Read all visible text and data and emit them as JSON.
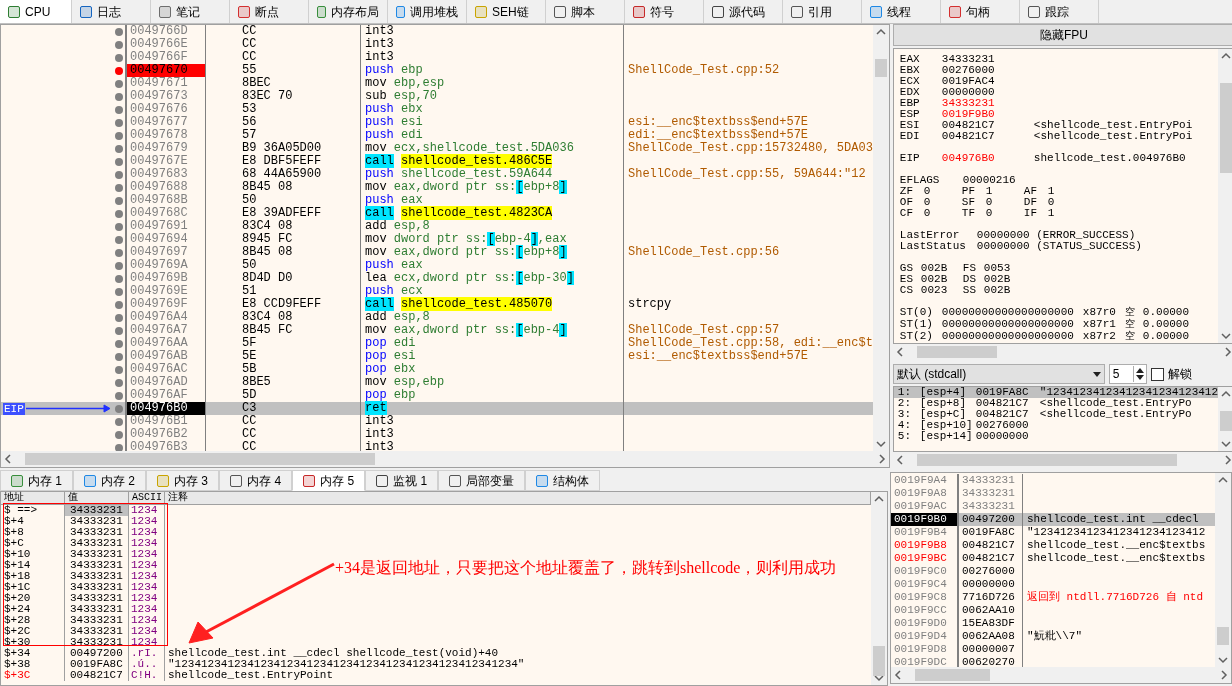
{
  "top_tabs": [
    {
      "label": "CPU",
      "selected": true
    },
    {
      "label": "日志",
      "selected": false
    },
    {
      "label": "笔记",
      "selected": false
    },
    {
      "label": "断点",
      "selected": false
    },
    {
      "label": "内存布局",
      "selected": false
    },
    {
      "label": "调用堆栈",
      "selected": false
    },
    {
      "label": "SEH链",
      "selected": false
    },
    {
      "label": "脚本",
      "selected": false
    },
    {
      "label": "符号",
      "selected": false
    },
    {
      "label": "源代码",
      "selected": false
    },
    {
      "label": "引用",
      "selected": false
    },
    {
      "label": "线程",
      "selected": false
    },
    {
      "label": "句柄",
      "selected": false
    },
    {
      "label": "跟踪",
      "selected": false
    }
  ],
  "disassembly": {
    "eip_label": "EIP",
    "rows": [
      {
        "address": "0049766D",
        "bytes": "CC",
        "mnemonic": "int3",
        "kind": "other",
        "breakpoint": false,
        "eip": false
      },
      {
        "address": "0049766E",
        "bytes": "CC",
        "mnemonic": "int3",
        "kind": "other",
        "breakpoint": false,
        "eip": false
      },
      {
        "address": "0049766F",
        "bytes": "CC",
        "mnemonic": "int3",
        "kind": "other",
        "breakpoint": false,
        "eip": false
      },
      {
        "address": "00497670",
        "bytes": "55",
        "mnemonic": "push",
        "operands": "ebp",
        "comment": "ShellCode_Test.cpp:52",
        "kind": "stack",
        "breakpoint": true,
        "eip": false
      },
      {
        "address": "00497671",
        "bytes": "8BEC",
        "mnemonic": "mov",
        "operands": "ebp,esp",
        "kind": "other",
        "breakpoint": false,
        "eip": false
      },
      {
        "address": "00497673",
        "bytes": "83EC 70",
        "mnemonic": "sub",
        "operands": "esp,70",
        "kind": "other",
        "breakpoint": false,
        "eip": false
      },
      {
        "address": "00497676",
        "bytes": "53",
        "mnemonic": "push",
        "operands": "ebx",
        "kind": "stack",
        "breakpoint": false,
        "eip": false
      },
      {
        "address": "00497677",
        "bytes": "56",
        "mnemonic": "push",
        "operands": "esi",
        "comment": "esi:__enc$textbss$end+57E",
        "kind": "stack",
        "breakpoint": false,
        "eip": false
      },
      {
        "address": "00497678",
        "bytes": "57",
        "mnemonic": "push",
        "operands": "edi",
        "comment": "edi:__enc$textbss$end+57E",
        "kind": "stack",
        "breakpoint": false,
        "eip": false
      },
      {
        "address": "00497679",
        "bytes": "B9 36A05D00",
        "mnemonic": "mov",
        "operands": "ecx,shellcode_test.5DA036",
        "comment": "ShellCode_Test.cpp:15732480, 5DA03",
        "kind": "other",
        "breakpoint": false,
        "eip": false
      },
      {
        "address": "0049767E",
        "bytes": "E8 DBF5FEFF",
        "mnemonic": "call",
        "operands": "shellcode_test.486C5E",
        "kind": "call",
        "breakpoint": false,
        "eip": false
      },
      {
        "address": "00497683",
        "bytes": "68 44A65900",
        "mnemonic": "push",
        "operands": "shellcode_test.59A644",
        "comment": "ShellCode_Test.cpp:55, 59A644:\"12",
        "kind": "stack",
        "breakpoint": false,
        "eip": false
      },
      {
        "address": "00497688",
        "bytes": "8B45 08",
        "mnemonic": "mov",
        "operands": "eax,dword ptr ss:[ebp+8]",
        "kind": "other",
        "breakpoint": false,
        "eip": false
      },
      {
        "address": "0049768B",
        "bytes": "50",
        "mnemonic": "push",
        "operands": "eax",
        "kind": "stack",
        "breakpoint": false,
        "eip": false
      },
      {
        "address": "0049768C",
        "bytes": "E8 39ADFEFF",
        "mnemonic": "call",
        "operands": "shellcode_test.4823CA",
        "kind": "call",
        "breakpoint": false,
        "eip": false
      },
      {
        "address": "00497691",
        "bytes": "83C4 08",
        "mnemonic": "add",
        "operands": "esp,8",
        "kind": "other",
        "breakpoint": false,
        "eip": false
      },
      {
        "address": "00497694",
        "bytes": "8945 FC",
        "mnemonic": "mov",
        "operands": "dword ptr ss:[ebp-4],eax",
        "kind": "other",
        "breakpoint": false,
        "eip": false
      },
      {
        "address": "00497697",
        "bytes": "8B45 08",
        "mnemonic": "mov",
        "operands": "eax,dword ptr ss:[ebp+8]",
        "comment": "ShellCode_Test.cpp:56",
        "kind": "other",
        "breakpoint": false,
        "eip": false
      },
      {
        "address": "0049769A",
        "bytes": "50",
        "mnemonic": "push",
        "operands": "eax",
        "kind": "stack",
        "breakpoint": false,
        "eip": false
      },
      {
        "address": "0049769B",
        "bytes": "8D4D D0",
        "mnemonic": "lea",
        "operands": "ecx,dword ptr ss:[ebp-30]",
        "kind": "other",
        "breakpoint": false,
        "eip": false
      },
      {
        "address": "0049769E",
        "bytes": "51",
        "mnemonic": "push",
        "operands": "ecx",
        "kind": "stack",
        "breakpoint": false,
        "eip": false
      },
      {
        "address": "0049769F",
        "bytes": "E8 CCD9FEFF",
        "mnemonic": "call",
        "operands": "shellcode_test.485070",
        "comment": "strcpy",
        "color": "#000000",
        "kind": "call",
        "breakpoint": false,
        "eip": false
      },
      {
        "address": "004976A4",
        "bytes": "83C4 08",
        "mnemonic": "add",
        "operands": "esp,8",
        "kind": "other",
        "breakpoint": false,
        "eip": false
      },
      {
        "address": "004976A7",
        "bytes": "8B45 FC",
        "mnemonic": "mov",
        "operands": "eax,dword ptr ss:[ebp-4]",
        "comment": "ShellCode_Test.cpp:57",
        "kind": "other",
        "breakpoint": false,
        "eip": false
      },
      {
        "address": "004976AA",
        "bytes": "5F",
        "mnemonic": "pop",
        "operands": "edi",
        "comment": "ShellCode_Test.cpp:58, edi:__enc$t",
        "kind": "stack",
        "breakpoint": false,
        "eip": false
      },
      {
        "address": "004976AB",
        "bytes": "5E",
        "mnemonic": "pop",
        "operands": "esi",
        "comment": "esi:__enc$textbss$end+57E",
        "kind": "stack",
        "breakpoint": false,
        "eip": false
      },
      {
        "address": "004976AC",
        "bytes": "5B",
        "mnemonic": "pop",
        "operands": "ebx",
        "kind": "stack",
        "breakpoint": false,
        "eip": false
      },
      {
        "address": "004976AD",
        "bytes": "8BE5",
        "mnemonic": "mov",
        "operands": "esp,ebp",
        "kind": "other",
        "breakpoint": false,
        "eip": false
      },
      {
        "address": "004976AF",
        "bytes": "5D",
        "mnemonic": "pop",
        "operands": "ebp",
        "kind": "stack",
        "breakpoint": false,
        "eip": false
      },
      {
        "address": "004976B0",
        "bytes": "C3",
        "mnemonic": "ret",
        "kind": "ret",
        "breakpoint": false,
        "eip": true
      },
      {
        "address": "004976B1",
        "bytes": "CC",
        "mnemonic": "int3",
        "kind": "other",
        "breakpoint": false,
        "eip": false
      },
      {
        "address": "004976B2",
        "bytes": "CC",
        "mnemonic": "int3",
        "kind": "other",
        "breakpoint": false,
        "eip": false
      },
      {
        "address": "004976B3",
        "bytes": "CC",
        "mnemonic": "int3",
        "kind": "other",
        "breakpoint": false,
        "eip": false
      }
    ]
  },
  "registers_panel": {
    "hide_fpu_button": "隐藏FPU",
    "registers": [
      {
        "name": "EAX",
        "value": "34333231",
        "changed": false
      },
      {
        "name": "EBX",
        "value": "00276000",
        "changed": false
      },
      {
        "name": "ECX",
        "value": "0019FAC4",
        "changed": false
      },
      {
        "name": "EDX",
        "value": "00000000",
        "changed": false
      },
      {
        "name": "EBP",
        "value": "34333231",
        "changed": true
      },
      {
        "name": "ESP",
        "value": "0019F9B0",
        "changed": true
      },
      {
        "name": "ESI",
        "value": "004821C7",
        "info": "<shellcode_test.EntryPoi",
        "changed": false
      },
      {
        "name": "EDI",
        "value": "004821C7",
        "info": "<shellcode_test.EntryPoi",
        "changed": false
      }
    ],
    "eip": {
      "name": "EIP",
      "value": "004976B0",
      "info": "shellcode_test.004976B0",
      "changed": true
    },
    "eflags": {
      "name": "EFLAGS",
      "value": "00000216"
    },
    "flags": [
      {
        "name": "ZF",
        "value": "0"
      },
      {
        "name": "PF",
        "value": "1"
      },
      {
        "name": "AF",
        "value": "1"
      },
      {
        "name": "OF",
        "value": "0"
      },
      {
        "name": "SF",
        "value": "0"
      },
      {
        "name": "DF",
        "value": "0"
      },
      {
        "name": "CF",
        "value": "0"
      },
      {
        "name": "TF",
        "value": "0"
      },
      {
        "name": "IF",
        "value": "1"
      }
    ],
    "last": [
      {
        "name": "LastError",
        "value": "00000000 (ERROR_SUCCESS)"
      },
      {
        "name": "LastStatus",
        "value": "00000000 (STATUS_SUCCESS)"
      }
    ],
    "segments": [
      {
        "name": "GS",
        "value": "002B"
      },
      {
        "name": "FS",
        "value": "0053"
      },
      {
        "name": "ES",
        "value": "002B"
      },
      {
        "name": "DS",
        "value": "002B"
      },
      {
        "name": "CS",
        "value": "0023"
      },
      {
        "name": "SS",
        "value": "002B"
      }
    ],
    "fpu": [
      {
        "name": "ST(0)",
        "value": "00000000000000000000",
        "reg": "x87r0",
        "tag": "空",
        "float": "0.00000"
      },
      {
        "name": "ST(1)",
        "value": "00000000000000000000",
        "reg": "x87r1",
        "tag": "空",
        "float": "0.00000"
      },
      {
        "name": "ST(2)",
        "value": "00000000000000000000",
        "reg": "x87r2",
        "tag": "空",
        "float": "0.00000"
      }
    ]
  },
  "call_args": {
    "convention": "默认 (stdcall)",
    "count": "5",
    "unlock": {
      "label": "解锁",
      "checked": false
    },
    "rows": [
      {
        "index": "1:",
        "slot": "[esp+4]",
        "value": "0019FA8C",
        "info": "\"12341234123412341234123412",
        "selected": true
      },
      {
        "index": "2:",
        "slot": "[esp+8]",
        "value": "004821C7",
        "info": "<shellcode_test.EntryPo",
        "selected": false
      },
      {
        "index": "3:",
        "slot": "[esp+C]",
        "value": "004821C7",
        "info": "<shellcode_test.EntryPo",
        "selected": false
      },
      {
        "index": "4:",
        "slot": "[esp+10]",
        "value": "00276000",
        "selected": false
      },
      {
        "index": "5:",
        "slot": "[esp+14]",
        "value": "00000000",
        "selected": false
      }
    ]
  },
  "bottom_tabs": [
    {
      "label": "内存 1",
      "selected": false
    },
    {
      "label": "内存 2",
      "selected": false
    },
    {
      "label": "内存 3",
      "selected": false
    },
    {
      "label": "内存 4",
      "selected": false
    },
    {
      "label": "内存 5",
      "selected": true
    },
    {
      "label": "监视 1",
      "selected": false
    },
    {
      "label": "局部变量",
      "selected": false
    },
    {
      "label": "结构体",
      "selected": false
    }
  ],
  "dump": {
    "columns": [
      "地址",
      "值",
      "ASCII",
      "注释"
    ],
    "rows": [
      {
        "address": "$ ==>",
        "value": "34333231",
        "ascii": "1234",
        "selected": true,
        "changed": false
      },
      {
        "address": "$+4",
        "value": "34333231",
        "ascii": "1234",
        "selected": false,
        "changed": false
      },
      {
        "address": "$+8",
        "value": "34333231",
        "ascii": "1234",
        "selected": false,
        "changed": false
      },
      {
        "address": "$+C",
        "value": "34333231",
        "ascii": "1234",
        "selected": false,
        "changed": false
      },
      {
        "address": "$+10",
        "value": "34333231",
        "ascii": "1234",
        "selected": false,
        "changed": false
      },
      {
        "address": "$+14",
        "value": "34333231",
        "ascii": "1234",
        "selected": false,
        "changed": false
      },
      {
        "address": "$+18",
        "value": "34333231",
        "ascii": "1234",
        "selected": false,
        "changed": false
      },
      {
        "address": "$+1C",
        "value": "34333231",
        "ascii": "1234",
        "selected": false,
        "changed": false
      },
      {
        "address": "$+20",
        "value": "34333231",
        "ascii": "1234",
        "selected": false,
        "changed": false
      },
      {
        "address": "$+24",
        "value": "34333231",
        "ascii": "1234",
        "selected": false,
        "changed": false
      },
      {
        "address": "$+28",
        "value": "34333231",
        "ascii": "1234",
        "selected": false,
        "changed": false
      },
      {
        "address": "$+2C",
        "value": "34333231",
        "ascii": "1234",
        "selected": false,
        "changed": false
      },
      {
        "address": "$+30",
        "value": "34333231",
        "ascii": "1234",
        "selected": false,
        "changed": false
      },
      {
        "address": "$+34",
        "value": "00497200",
        "ascii": ".rI.",
        "comment": "shellcode_test.int __cdecl shellcode_test(void)+40",
        "selected": false,
        "changed": false
      },
      {
        "address": "$+38",
        "value": "0019FA8C",
        "ascii": ".ú..",
        "comment": "\"1234123412341234123412341234123412341234123412341234\"",
        "selected": false,
        "changed": false
      },
      {
        "address": "$+3C",
        "value": "004821C7",
        "ascii": "C!H.",
        "comment": "shellcode_test.EntryPoint",
        "selected": false,
        "changed": true
      }
    ]
  },
  "stack": {
    "rows": [
      {
        "address": "0019F9A4",
        "value": "34333231",
        "dim": true,
        "selected": false,
        "changed": false
      },
      {
        "address": "0019F9A8",
        "value": "34333231",
        "dim": true,
        "selected": false,
        "changed": false
      },
      {
        "address": "0019F9AC",
        "value": "34333231",
        "dim": true,
        "selected": false,
        "changed": false
      },
      {
        "address": "0019F9B0",
        "value": "00497200",
        "comment": "shellcode_test.int __cdecl",
        "dim": false,
        "selected": true,
        "changed": false
      },
      {
        "address": "0019F9B4",
        "value": "0019FA8C",
        "comment": "\"12341234123412341234123412",
        "dim": false,
        "selected": false,
        "changed": false
      },
      {
        "address": "0019F9B8",
        "value": "004821C7",
        "comment": "shellcode_test.__enc$textbs",
        "dim": false,
        "selected": false,
        "changed": true
      },
      {
        "address": "0019F9BC",
        "value": "004821C7",
        "comment": "shellcode_test.__enc$textbs",
        "dim": false,
        "selected": false,
        "changed": true
      },
      {
        "address": "0019F9C0",
        "value": "00276000",
        "dim": false,
        "selected": false,
        "changed": false
      },
      {
        "address": "0019F9C4",
        "value": "00000000",
        "dim": false,
        "selected": false,
        "changed": false
      },
      {
        "address": "0019F9C8",
        "value": "7716D726",
        "comment": "返回到 ntdll.7716D726 自 ntd",
        "color": "#ff0000",
        "dim": false,
        "selected": false,
        "changed": false
      },
      {
        "address": "0019F9CC",
        "value": "0062AA10",
        "dim": false,
        "selected": false,
        "changed": false
      },
      {
        "address": "0019F9D0",
        "value": "15EA83DF",
        "dim": false,
        "selected": false,
        "changed": false
      },
      {
        "address": "0019F9D4",
        "value": "0062AA08",
        "comment": "\"魭粃\\\\7\"",
        "dim": false,
        "selected": false,
        "changed": false
      },
      {
        "address": "0019F9D8",
        "value": "00000007",
        "dim": false,
        "selected": false,
        "changed": false
      },
      {
        "address": "0019F9DC",
        "value": "00620270",
        "dim": false,
        "selected": false,
        "changed": false
      }
    ]
  },
  "annotation": "+34是返回地址，只要把这个地址覆盖了，跳转到shellcode，则利用成功"
}
